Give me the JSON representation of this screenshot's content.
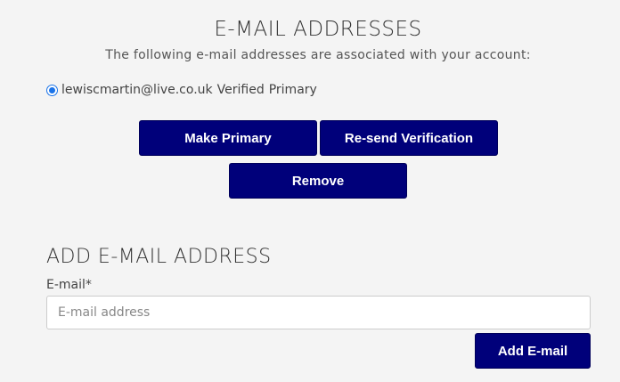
{
  "header": {
    "title": "E-MAIL ADDRESSES",
    "subtitle": "The following e-mail addresses are associated with your account:"
  },
  "emails": [
    {
      "address": "lewiscmartin@live.co.uk",
      "status": "Verified",
      "primary_label": "Primary",
      "selected": true
    }
  ],
  "actions": {
    "make_primary": "Make Primary",
    "resend": "Re-send Verification",
    "remove": "Remove"
  },
  "add_section": {
    "title": "ADD E-MAIL ADDRESS",
    "field_label": "E-mail*",
    "placeholder": "E-mail address",
    "value": "",
    "submit_label": "Add E-mail"
  },
  "colors": {
    "button_bg": "#00007a",
    "radio_accent": "#1a73e8",
    "background": "#f4f4f4"
  }
}
